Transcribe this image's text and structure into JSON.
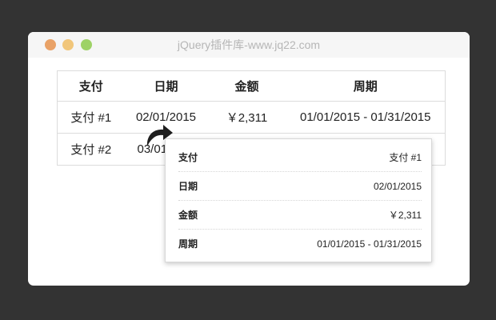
{
  "window": {
    "title": "jQuery插件库-www.jq22.com"
  },
  "table": {
    "headers": [
      "支付",
      "日期",
      "金额",
      "周期"
    ],
    "rows": [
      [
        "支付 #1",
        "02/01/2015",
        "￥2,311",
        "01/01/2015 - 01/31/2015"
      ],
      [
        "支付 #2",
        "03/01",
        "",
        ""
      ]
    ]
  },
  "popup": {
    "rows": [
      {
        "key": "支付",
        "value": "支付 #1"
      },
      {
        "key": "日期",
        "value": "02/01/2015"
      },
      {
        "key": "金额",
        "value": "￥2,311"
      },
      {
        "key": "周期",
        "value": "01/01/2015 - 01/31/2015"
      }
    ]
  },
  "colors": {
    "background": "#333333",
    "window": "#ffffff",
    "traffic_red": "#e9a267",
    "traffic_yellow": "#f1c67a",
    "traffic_green": "#9ed266"
  },
  "icons": {
    "arrow": "curved-arrow-icon"
  }
}
